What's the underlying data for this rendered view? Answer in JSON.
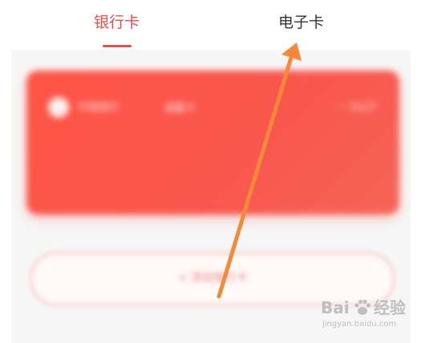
{
  "tabs": {
    "bank_card": "银行卡",
    "e_card": "电子卡"
  },
  "card": {
    "bank_name": "中国银行",
    "card_type": "储蓄卡",
    "card_number": "···· 5127"
  },
  "add_button": {
    "label": "+ 添加银行卡"
  },
  "watermark": {
    "brand_left": "Bai",
    "brand_right": "经验",
    "sub": "jingyan.baidu.com"
  },
  "colors": {
    "accent": "#e84f4a",
    "card_red": "#fa5549",
    "arrow_orange": "#f5893a"
  },
  "icons": {
    "arrow": "orange-arrow-icon",
    "watermark_paw": "paw-icon"
  }
}
